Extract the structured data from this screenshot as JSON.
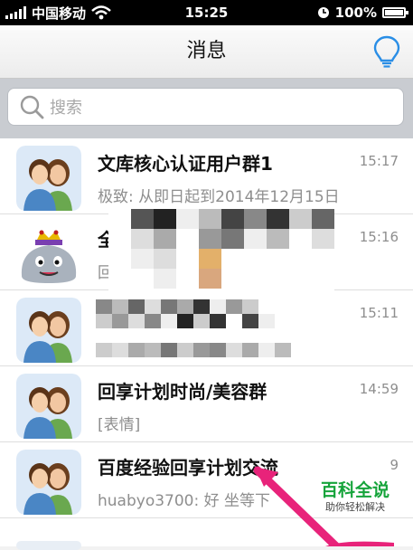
{
  "status_bar": {
    "carrier": "中国移动",
    "time": "15:25",
    "battery": "100%",
    "battery_level": 1.0
  },
  "nav": {
    "title": "消息"
  },
  "search": {
    "placeholder": "搜索"
  },
  "conversations": [
    {
      "name": "文库核心认证用户群1",
      "time": "15:17",
      "preview": "极致: 从即日起到2014年12月15日"
    },
    {
      "name": "全",
      "time": "15:16",
      "preview": "回"
    },
    {
      "name": "",
      "time": "15:11",
      "preview": ""
    },
    {
      "name": "回享计划时尚/美容群",
      "time": "14:59",
      "preview": "[表情]"
    },
    {
      "name": "百度经验回享计划交流",
      "time": "9",
      "preview": "huabyo3700: 好   坐等下"
    }
  ],
  "watermark": {
    "title": "百科全说",
    "subtitle": "助你轻松解决"
  },
  "colors": {
    "accent_blue": "#2a8ee6",
    "watermark_green": "#16a43b",
    "arrow_pink": "#e8237a"
  }
}
